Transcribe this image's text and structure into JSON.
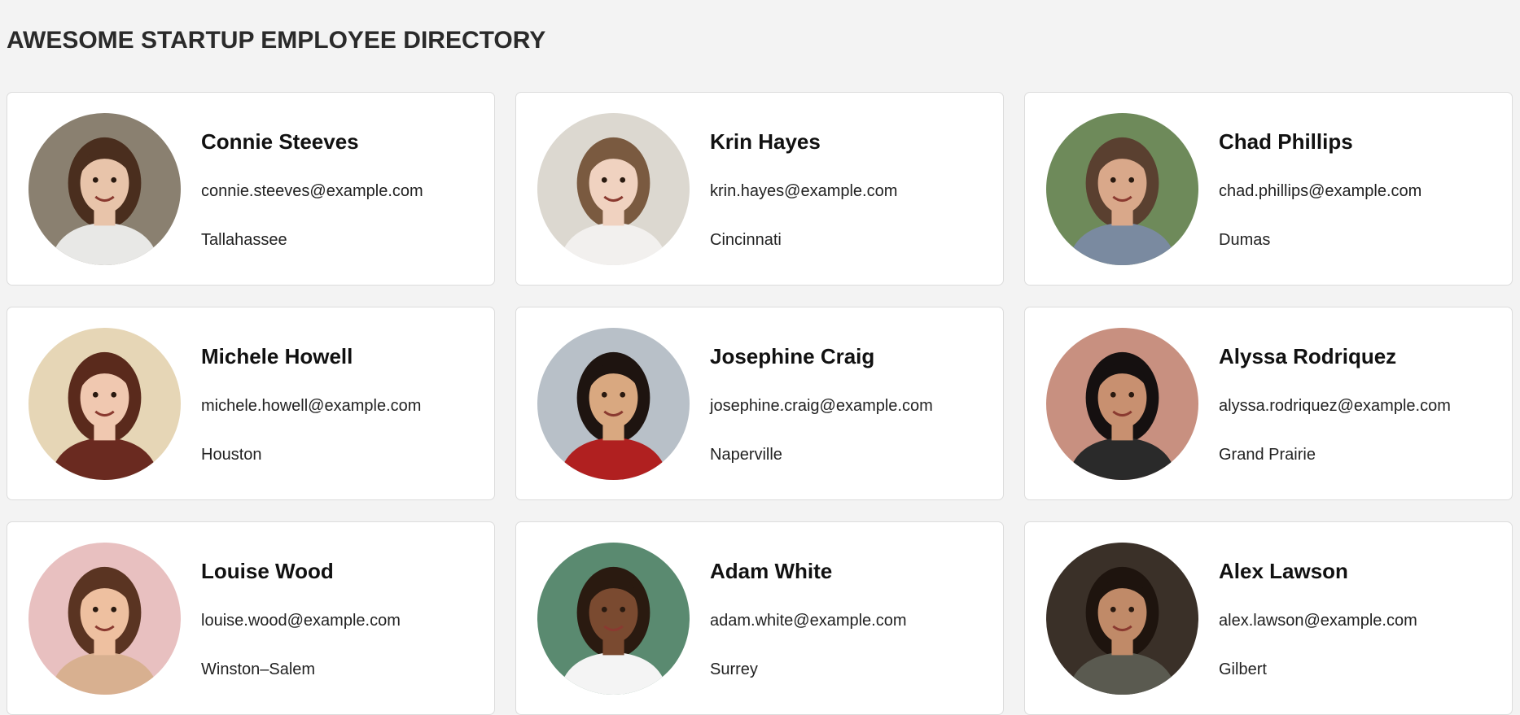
{
  "header": {
    "title": "AWESOME STARTUP EMPLOYEE DIRECTORY"
  },
  "employees": [
    {
      "name": "Connie Steeves",
      "email": "connie.steeves@example.com",
      "city": "Tallahassee",
      "avatar": {
        "bg": "#8a8070",
        "skin": "#e8c4aa",
        "hair": "#4a2e1e",
        "shirt": "#e8e8e6"
      }
    },
    {
      "name": "Krin Hayes",
      "email": "krin.hayes@example.com",
      "city": "Cincinnati",
      "avatar": {
        "bg": "#dcd8d0",
        "skin": "#f0d2c0",
        "hair": "#7a5a40",
        "shirt": "#f2f0ee"
      }
    },
    {
      "name": "Chad Phillips",
      "email": "chad.phillips@example.com",
      "city": "Dumas",
      "avatar": {
        "bg": "#6e8a5a",
        "skin": "#d9a88a",
        "hair": "#5a4030",
        "shirt": "#7a8aa0"
      }
    },
    {
      "name": "Michele Howell",
      "email": "michele.howell@example.com",
      "city": "Houston",
      "avatar": {
        "bg": "#e6d6b6",
        "skin": "#f0c8b0",
        "hair": "#5a2a1c",
        "shirt": "#6a2a20"
      }
    },
    {
      "name": "Josephine Craig",
      "email": "josephine.craig@example.com",
      "city": "Naperville",
      "avatar": {
        "bg": "#b8c0c8",
        "skin": "#d9a880",
        "hair": "#1e1410",
        "shirt": "#b02020"
      }
    },
    {
      "name": "Alyssa Rodriquez",
      "email": "alyssa.rodriquez@example.com",
      "city": "Grand Prairie",
      "avatar": {
        "bg": "#c89080",
        "skin": "#c89070",
        "hair": "#151010",
        "shirt": "#2a2a2a"
      }
    },
    {
      "name": "Louise Wood",
      "email": "louise.wood@example.com",
      "city": "Winston–Salem",
      "avatar": {
        "bg": "#e8c0c0",
        "skin": "#eec0a0",
        "hair": "#5a3422",
        "shirt": "#d8b090"
      }
    },
    {
      "name": "Adam White",
      "email": "adam.white@example.com",
      "city": "Surrey",
      "avatar": {
        "bg": "#5a8a70",
        "skin": "#7a4a30",
        "hair": "#2a1a10",
        "shirt": "#f4f4f4"
      }
    },
    {
      "name": "Alex Lawson",
      "email": "alex.lawson@example.com",
      "city": "Gilbert",
      "avatar": {
        "bg": "#3a3028",
        "skin": "#c08a68",
        "hair": "#1e140e",
        "shirt": "#5a5a50"
      }
    }
  ]
}
